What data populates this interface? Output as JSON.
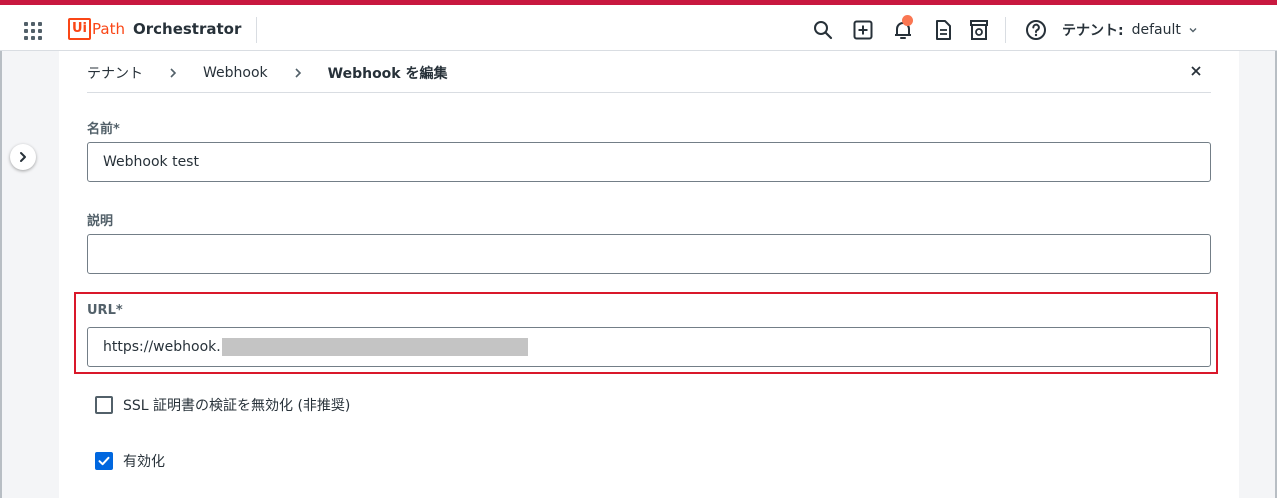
{
  "header": {
    "logo_box": "Ui",
    "logo_path": "Path",
    "product": "Orchestrator",
    "tenant_label": "テナント:",
    "tenant_value": "default"
  },
  "breadcrumb": {
    "items": [
      "テナント",
      "Webhook",
      "Webhook を編集"
    ]
  },
  "form": {
    "name_label": "名前*",
    "name_value": "Webhook test",
    "description_label": "説明",
    "description_value": "",
    "url_label": "URL*",
    "url_value": "https://webhook.",
    "ssl_label": "SSL 証明書の検証を無効化 (非推奨)",
    "ssl_checked": false,
    "enabled_label": "有効化",
    "enabled_checked": true
  },
  "colors": {
    "brand": "#fa4616",
    "accent_line": "#c8183f",
    "highlight": "#d9182a",
    "checkbox_on": "#0067df",
    "notification": "#fa7652"
  },
  "icons": [
    "apps-grid-icon",
    "search-icon",
    "add-icon",
    "bell-icon",
    "document-icon",
    "store-icon",
    "help-icon",
    "chevron-down-icon",
    "chevron-right-icon",
    "close-icon",
    "check-icon"
  ]
}
